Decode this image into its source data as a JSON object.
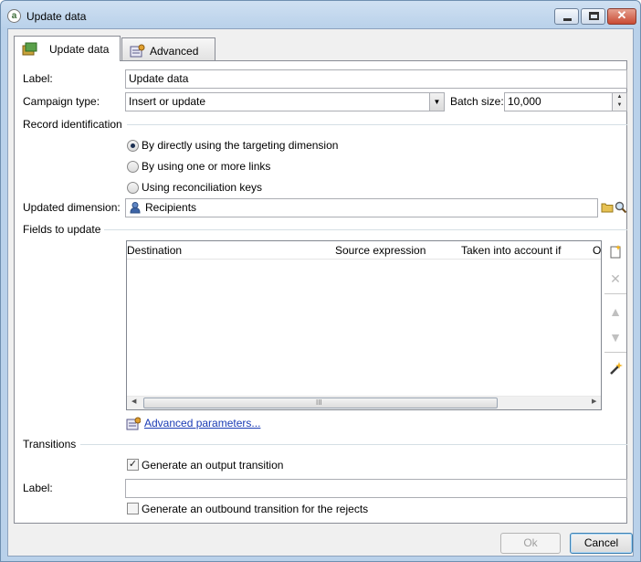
{
  "window": {
    "title": "Update data",
    "app_icon_glyph": "a"
  },
  "tabs": [
    {
      "label": "Update data",
      "icon": "update-data-icon"
    },
    {
      "label": "Advanced",
      "icon": "advanced-icon"
    }
  ],
  "form": {
    "label_caption": "Label:",
    "label_value": "Update data",
    "campaign_type_caption": "Campaign type:",
    "campaign_type_value": "Insert or update",
    "batch_size_caption": "Batch size:",
    "batch_size_value": "10,000"
  },
  "record_identification": {
    "heading": "Record identification",
    "options": [
      {
        "label": "By directly using the targeting dimension",
        "selected": true
      },
      {
        "label": "By using one or more links",
        "selected": false
      },
      {
        "label": "Using reconciliation keys",
        "selected": false
      }
    ],
    "updated_dimension_caption": "Updated dimension:",
    "updated_dimension_value": "Recipients"
  },
  "fields_to_update": {
    "heading": "Fields to update",
    "columns": [
      "Destination",
      "Source expression",
      "Taken into account if",
      "O"
    ],
    "scroll_grip": "III",
    "advanced_parameters_link": "Advanced parameters..."
  },
  "transitions": {
    "heading": "Transitions",
    "generate_output_label": "Generate an output transition",
    "generate_output_checked": true,
    "label_caption": "Label:",
    "label_value": "",
    "generate_rejects_label": "Generate an outbound transition for the rejects",
    "generate_rejects_checked": false
  },
  "buttons": {
    "ok": "Ok",
    "cancel": "Cancel"
  },
  "colors": {
    "link": "#1a3bb5",
    "title_bar": "#b9d1ea",
    "close_button": "#c94a33"
  }
}
